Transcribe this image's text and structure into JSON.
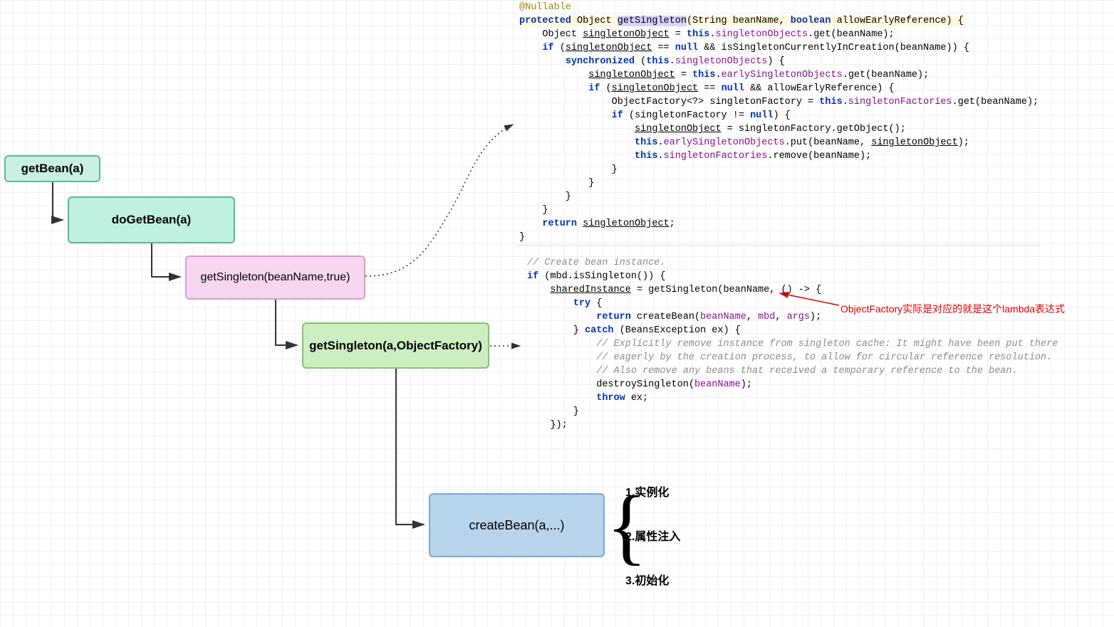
{
  "diagram": {
    "nodes": {
      "getBean": "getBean(a)",
      "doGetBean": "doGetBean(a)",
      "getSingleton1": "getSingleton(beanName,true)",
      "getSingleton2": "getSingleton(a,ObjectFactory)",
      "createBean": "createBean(a,...)"
    },
    "steps": {
      "s1": "1.实例化",
      "s2": "2.属性注入",
      "s3": "3.初始化"
    },
    "annotation": "ObjectFactory实际是对应的就是这个lambda表达式"
  },
  "code1": {
    "line1_ann": "@Nullable",
    "line2_a": "protected",
    "line2_b": " Object ",
    "line2_c": "getSingleton",
    "line2_d": "(String beanName, ",
    "line2_e": "boolean",
    "line2_f": " allowEarlyReference) {",
    "line3_a": "    Object ",
    "line3_b": "singletonObject",
    "line3_c": " = ",
    "line3_d": "this",
    "line3_e": ".",
    "line3_f": "singletonObjects",
    "line3_g": ".get(beanName);",
    "line4_a": "    ",
    "line4_b": "if",
    "line4_c": " (",
    "line4_d": "singletonObject",
    "line4_e": " == ",
    "line4_f": "null",
    "line4_g": " && isSingletonCurrentlyInCreation(beanName)) {",
    "line5_a": "        ",
    "line5_b": "synchronized",
    "line5_c": " (",
    "line5_d": "this",
    "line5_e": ".",
    "line5_f": "singletonObjects",
    "line5_g": ") {",
    "line6_a": "            ",
    "line6_b": "singletonObject",
    "line6_c": " = ",
    "line6_d": "this",
    "line6_e": ".",
    "line6_f": "earlySingletonObjects",
    "line6_g": ".get(beanName);",
    "line7_a": "            ",
    "line7_b": "if",
    "line7_c": " (",
    "line7_d": "singletonObject",
    "line7_e": " == ",
    "line7_f": "null",
    "line7_g": " && allowEarlyReference) {",
    "line8_a": "                ObjectFactory<?> singletonFactory = ",
    "line8_b": "this",
    "line8_c": ".",
    "line8_d": "singletonFactories",
    "line8_e": ".get(beanName);",
    "line9_a": "                ",
    "line9_b": "if",
    "line9_c": " (singletonFactory != ",
    "line9_d": "null",
    "line9_e": ") {",
    "line10_a": "                    ",
    "line10_b": "singletonObject",
    "line10_c": " = singletonFactory.getObject();",
    "line11_a": "                    ",
    "line11_b": "this",
    "line11_c": ".",
    "line11_d": "earlySingletonObjects",
    "line11_e": ".put(beanName, ",
    "line11_f": "singletonObject",
    "line11_g": ");",
    "line12_a": "                    ",
    "line12_b": "this",
    "line12_c": ".",
    "line12_d": "singletonFactories",
    "line12_e": ".remove(beanName);",
    "line13": "                }",
    "line14": "            }",
    "line15": "        }",
    "line16": "    }",
    "line17_a": "    ",
    "line17_b": "return",
    "line17_c": " ",
    "line17_d": "singletonObject",
    "line17_e": ";",
    "line18": "}"
  },
  "code2": {
    "line1": "// Create bean instance.",
    "line2_a": "if",
    "line2_b": " (mbd.isSingleton()) {",
    "line3_a": "    ",
    "line3_b": "sharedInstance",
    "line3_c": " = getSingleton(beanName, () -> {",
    "line4_a": "        ",
    "line4_b": "try",
    "line4_c": " {",
    "line5_a": "            ",
    "line5_b": "return",
    "line5_c": " createBean(",
    "line5_d": "beanName",
    "line5_e": ", ",
    "line5_f": "mbd",
    "line5_g": ", ",
    "line5_h": "args",
    "line5_i": ");",
    "line6_a": "        } ",
    "line6_b": "catch",
    "line6_c": " (BeansException ex) {",
    "line7": "            // Explicitly remove instance from singleton cache: It might have been put there",
    "line8": "            // eagerly by the creation process, to allow for circular reference resolution.",
    "line9": "            // Also remove any beans that received a temporary reference to the bean.",
    "line10_a": "            destroySingleton(",
    "line10_b": "beanName",
    "line10_c": ");",
    "line11_a": "            ",
    "line11_b": "throw",
    "line11_c": " ex;",
    "line12": "        }",
    "line13": "    });"
  }
}
